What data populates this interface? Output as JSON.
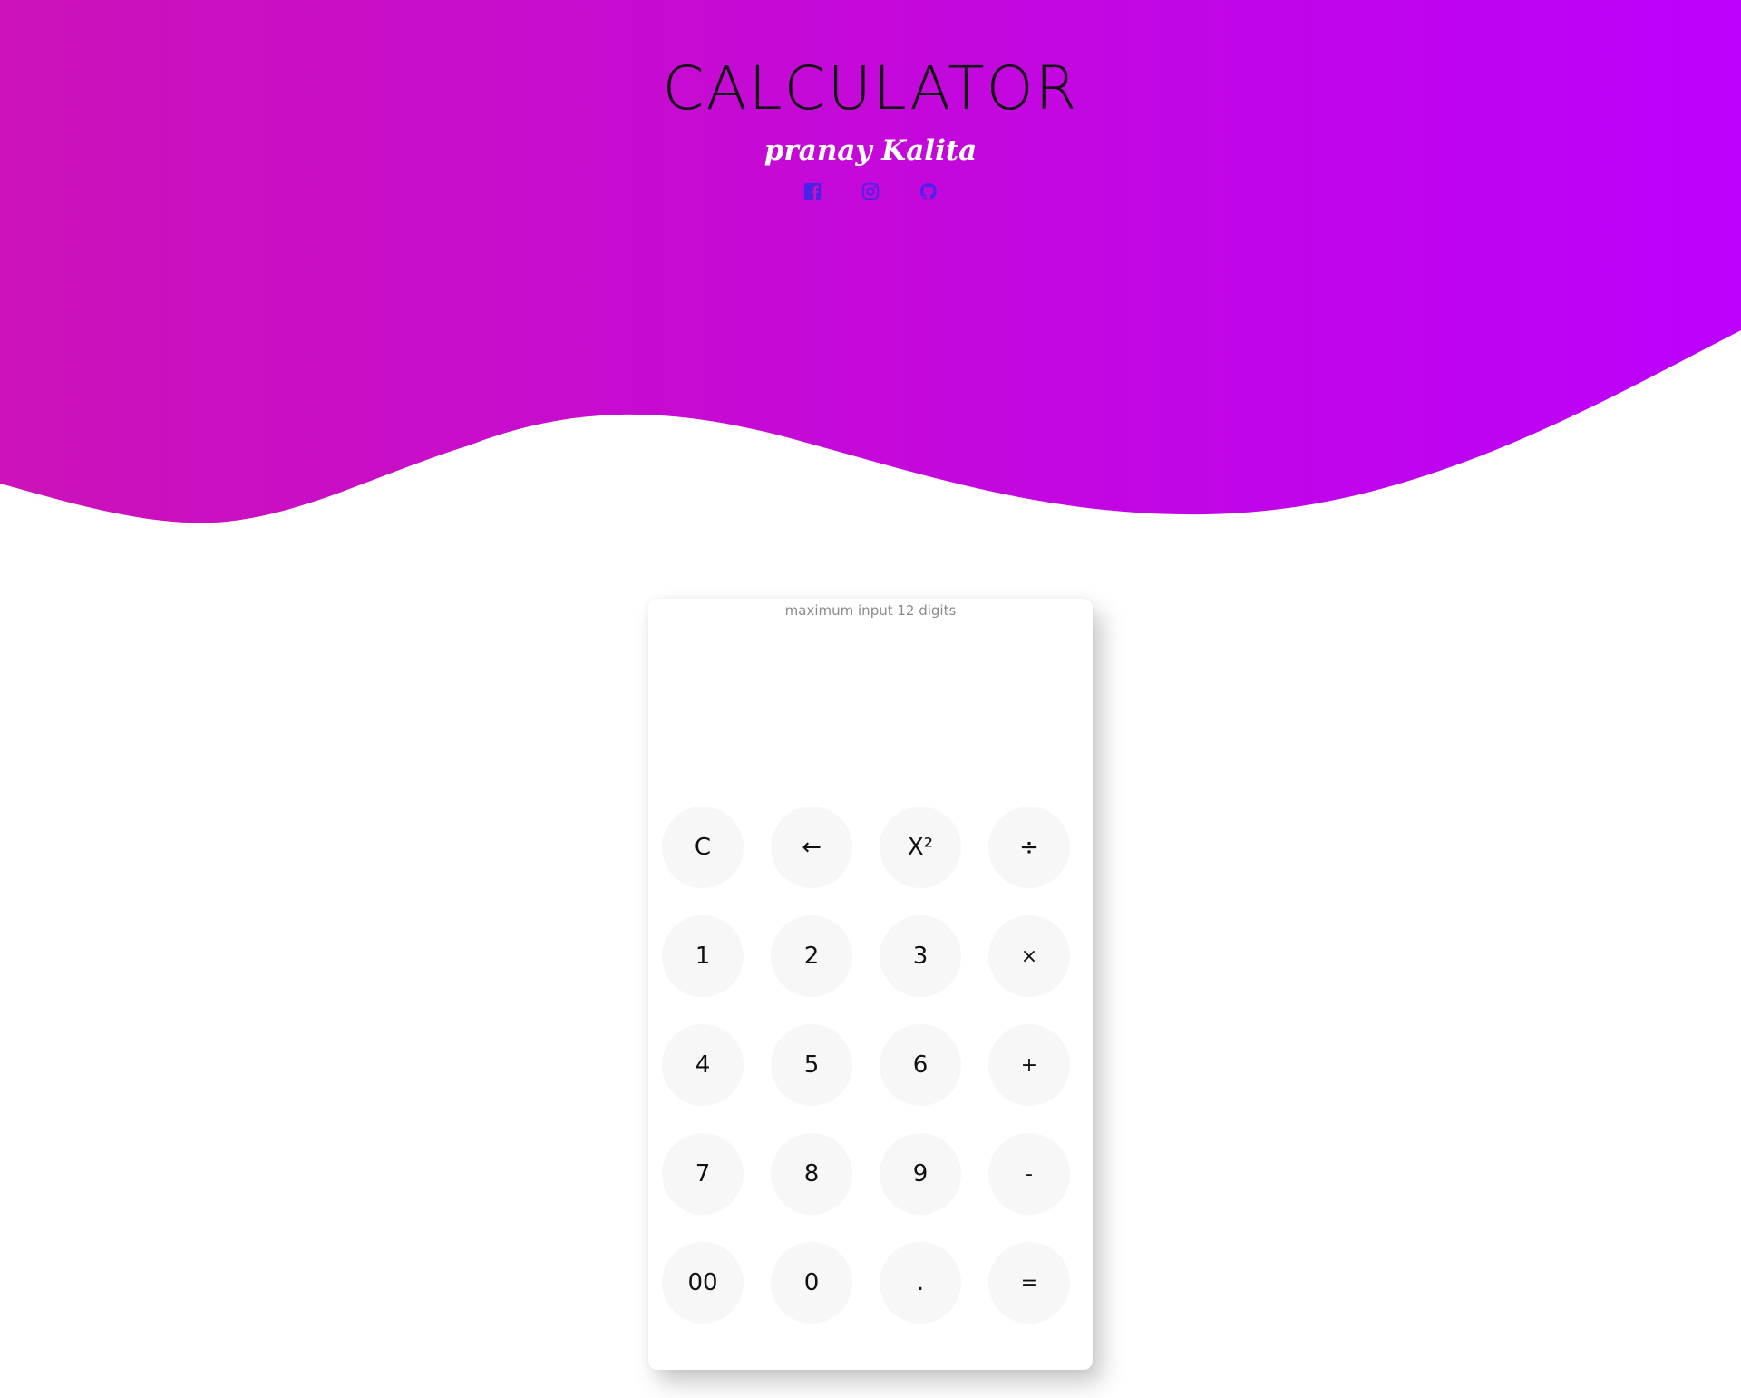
{
  "header": {
    "title": "CALCULATOR",
    "author": "pranay Kalita",
    "socials": [
      {
        "icon": "facebook-icon"
      },
      {
        "icon": "instagram-icon"
      },
      {
        "icon": "github-icon"
      }
    ]
  },
  "colors": {
    "gradient_start": "#cc12b8",
    "gradient_end": "#bc00fb",
    "social_icon": "#4a22e8",
    "key_bg": "#f7f7f7"
  },
  "calculator": {
    "hint": "maximum input 12 digits",
    "display_value": "",
    "keys": [
      {
        "label": "C",
        "name": "clear-button"
      },
      {
        "label": "←",
        "name": "backspace-button"
      },
      {
        "label": "X²",
        "name": "square-button"
      },
      {
        "label": "÷",
        "name": "divide-button"
      },
      {
        "label": "1",
        "name": "digit-1-button"
      },
      {
        "label": "2",
        "name": "digit-2-button"
      },
      {
        "label": "3",
        "name": "digit-3-button"
      },
      {
        "label": "×",
        "name": "multiply-button"
      },
      {
        "label": "4",
        "name": "digit-4-button"
      },
      {
        "label": "5",
        "name": "digit-5-button"
      },
      {
        "label": "6",
        "name": "digit-6-button"
      },
      {
        "label": "+",
        "name": "add-button"
      },
      {
        "label": "7",
        "name": "digit-7-button"
      },
      {
        "label": "8",
        "name": "digit-8-button"
      },
      {
        "label": "9",
        "name": "digit-9-button"
      },
      {
        "label": "-",
        "name": "subtract-button"
      },
      {
        "label": "00",
        "name": "double-zero-button"
      },
      {
        "label": "0",
        "name": "digit-0-button"
      },
      {
        "label": ".",
        "name": "decimal-button"
      },
      {
        "label": "=",
        "name": "equals-button"
      }
    ]
  }
}
